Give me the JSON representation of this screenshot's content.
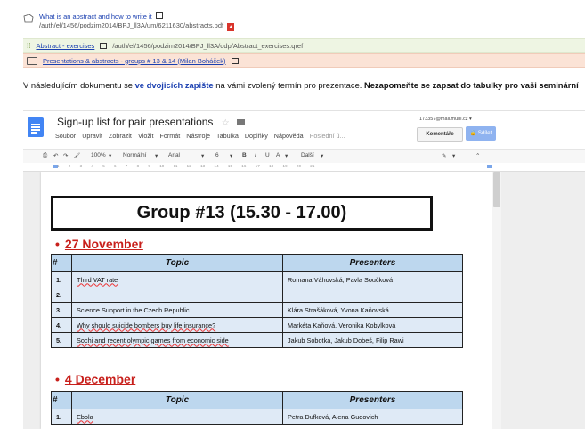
{
  "resources": [
    {
      "title": "What is an abstract and how to write it",
      "path": "/auth/el/1456/podzim2014/BPJ_ll3A/um/6211630/abstracts.pdf"
    },
    {
      "title": "Abstract - exercises",
      "path": "/auth/el/1456/podzim2014/BPJ_ll3A/odp/Abstract_exercises.qref"
    },
    {
      "title": "Presentations & abstracts - groups # 13 & 14 (Milan Boháček)",
      "path": ""
    }
  ],
  "instruction": {
    "lead": "V následujícím dokumentu se ",
    "highlight": "ve dvojicích zapište",
    "middle": " na vámi zvolený termín pro prezentace. ",
    "bold": "Nezapomeňte se zapsat do tabulky pro vaši seminární"
  },
  "doc": {
    "title": "Sign-up list for pair presentations",
    "account": "173357@mail.muni.cz",
    "menu": [
      "Soubor",
      "Upravit",
      "Zobrazit",
      "Vložit",
      "Formát",
      "Nástroje",
      "Tabulka",
      "Doplňky",
      "Nápověda",
      "Poslední ú..."
    ],
    "comments_label": "Komentáře",
    "share_label": "Sdílet",
    "toolbar": {
      "zoom": "100%",
      "style": "Normální",
      "font": "Arial",
      "size": "6",
      "more": "Další"
    },
    "ruler": "1 · · · 2 · · · 3 · · · 4 · · · 5 · · · 6 · · · 7 · · · 8 · · · 9 · · · 10 · · · 11 · · · 12 · · · 13 · · · 14 · · · 15 · · · 16 · · · 17 · · · 18 · · · 19 · · · 20 · · · 21"
  },
  "group_heading": "Group #13 (15.30 - 17.00)",
  "col_num": "#",
  "col_topic": "Topic",
  "col_presenters": "Presenters",
  "sessions": [
    {
      "date": "27 November",
      "rows": [
        {
          "n": "1.",
          "topic": "Third VAT rate",
          "presenters": "Romana Váhovská, Pavla Součková"
        },
        {
          "n": "2.",
          "topic": "",
          "presenters": ""
        },
        {
          "n": "3.",
          "topic": "Science Support in the Czech Republic",
          "presenters": "Klára Strašáková, Yvona Kaňovská"
        },
        {
          "n": "4.",
          "topic": "Why should suicide bombers buy life insurance?",
          "presenters": "Markéta Kaňová, Veronika Kobylková"
        },
        {
          "n": "5.",
          "topic": "Sochi and recent olympic games from economic side",
          "presenters": "Jakub Sobotka, Jakub Dobeš, Filip Rawi"
        }
      ]
    },
    {
      "date": "4 December",
      "rows": [
        {
          "n": "1.",
          "topic": "Ebola",
          "presenters": "Petra Dufková, Alena Gudovich"
        }
      ]
    }
  ]
}
